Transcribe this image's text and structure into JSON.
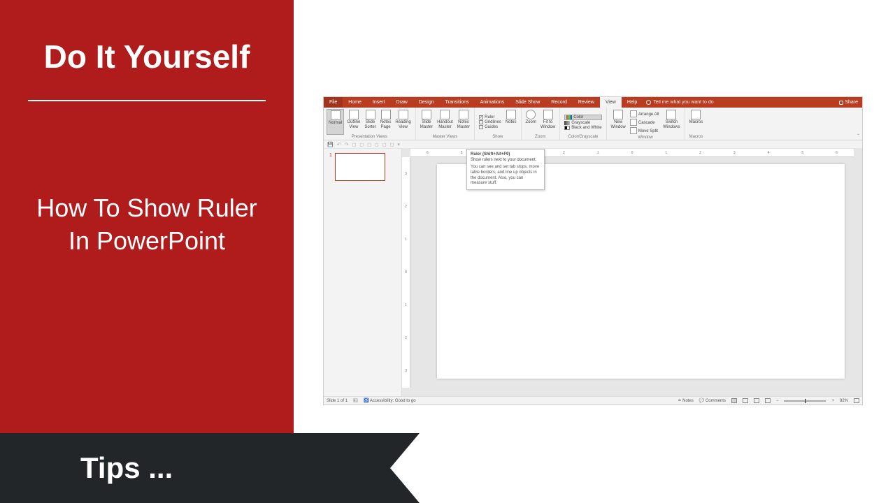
{
  "leftPanel": {
    "mainTitle": "Do It Yourself",
    "articleTitle": "How To Show Ruler In PowerPoint"
  },
  "banner": {
    "text": "Tips ..."
  },
  "tabs": {
    "file": "File",
    "list": [
      "Home",
      "Insert",
      "Draw",
      "Design",
      "Transitions",
      "Animations",
      "Slide Show",
      "Record",
      "Review",
      "View",
      "Help"
    ],
    "active": "View",
    "tellMe": "Tell me what you want to do",
    "share": "Share"
  },
  "ribbon": {
    "presViews": {
      "label": "Presentation Views",
      "normal": "Normal",
      "outline": "Outline\nView",
      "sorter": "Slide\nSorter",
      "notesPage": "Notes\nPage",
      "reading": "Reading\nView"
    },
    "masterViews": {
      "label": "Master Views",
      "slide": "Slide\nMaster",
      "handout": "Handout\nMaster",
      "notes": "Notes\nMaster"
    },
    "show": {
      "label": "Show",
      "ruler": "Ruler",
      "gridlines": "Gridlines",
      "guides": "Guides",
      "notes": "Notes"
    },
    "zoom": {
      "label": "Zoom",
      "zoom": "Zoom",
      "fit": "Fit to\nWindow"
    },
    "colorGray": {
      "label": "Color/Grayscale",
      "color": "Color",
      "gray": "Grayscale",
      "bw": "Black and White"
    },
    "window": {
      "label": "Window",
      "newWin": "New\nWindow",
      "arrange": "Arrange All",
      "cascade": "Cascade",
      "moveSplit": "Move Split",
      "switch": "Switch\nWindows"
    },
    "macros": {
      "label": "Macros",
      "macros": "Macros"
    }
  },
  "tooltip": {
    "title": "Ruler (Shift+Alt+F9)",
    "sub": "Show rulers next to your document.",
    "body": "You can see and set tab stops, move table borders, and line up objects in the document. Also, you can measure stuff."
  },
  "rulerTicks": [
    "6",
    "5",
    "4",
    "3",
    "2",
    "1",
    "0",
    "1",
    "2",
    "3",
    "4",
    "5",
    "6"
  ],
  "vRulerTicks": [
    "3",
    "2",
    "1",
    "0",
    "1",
    "2",
    "3"
  ],
  "thumb": {
    "num": "1"
  },
  "status": {
    "slideOf": "Slide 1 of 1",
    "access": "Accessibility: Good to go",
    "notes": "Notes",
    "comments": "Comments",
    "zoomPct": "82%"
  }
}
